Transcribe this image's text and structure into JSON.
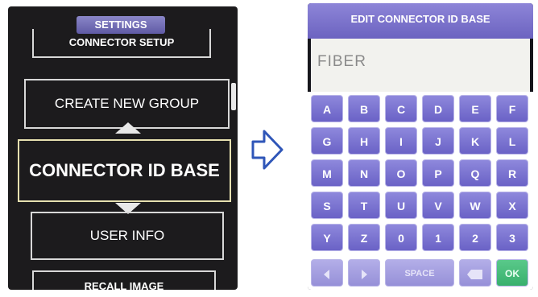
{
  "left_screen": {
    "title": "SETTINGS",
    "items": {
      "connector_setup": "CONNECTOR SETUP",
      "create_new_group": "CREATE NEW GROUP",
      "connector_id_base": "CONNECTOR ID BASE",
      "user_info": "USER INFO",
      "recall_image": "RECALL IMAGE"
    }
  },
  "transition_icon": "right-arrow-outline",
  "right_screen": {
    "title": "EDIT CONNECTOR ID BASE",
    "input_value": "FIBER",
    "keys": [
      [
        "A",
        "B",
        "C",
        "D",
        "E",
        "F"
      ],
      [
        "G",
        "H",
        "I",
        "J",
        "K",
        "L"
      ],
      [
        "M",
        "N",
        "O",
        "P",
        "Q",
        "R"
      ],
      [
        "S",
        "T",
        "U",
        "V",
        "W",
        "X"
      ],
      [
        "Y",
        "Z",
        "0",
        "1",
        "2",
        "3"
      ]
    ],
    "bottom_row": {
      "left_icon": "arrow-left",
      "right_icon": "arrow-right",
      "space_label": "SPACE",
      "backspace_icon": "backspace",
      "ok_label": "OK"
    }
  },
  "colors": {
    "accent_purple": "#6a62c6",
    "ok_green": "#38b06d",
    "screen_bg": "#1c1b1d"
  }
}
